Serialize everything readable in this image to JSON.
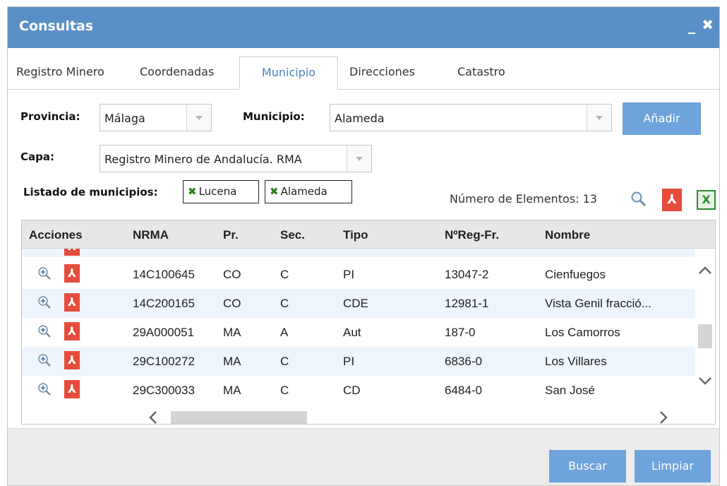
{
  "window": {
    "title": "Consultas",
    "minimize": "_",
    "close": "✖"
  },
  "tabs": [
    {
      "label": "Registro Minero"
    },
    {
      "label": "Coordenadas"
    },
    {
      "label": "Municipio"
    },
    {
      "label": "Direcciones"
    },
    {
      "label": "Catastro"
    }
  ],
  "form": {
    "provincia_label": "Provincia:",
    "provincia_value": "Málaga",
    "municipio_label": "Municipio:",
    "municipio_value": "Alameda",
    "add_label": "Añadir",
    "capa_label": "Capa:",
    "capa_value": "Registro Minero de Andalucía. RMA",
    "list_label": "Listado de municipios:",
    "chips": [
      {
        "label": "Lucena"
      },
      {
        "label": "Alameda"
      }
    ],
    "count_text": "Número de Elementos: 13"
  },
  "grid": {
    "headers": [
      "Acciones",
      "NRMA",
      "Pr.",
      "Sec.",
      "Tipo",
      "NºReg-Fr.",
      "Nombre"
    ],
    "rows": [
      {
        "nrma": "14C100645",
        "pr": "CO",
        "sec": "C",
        "tipo": "PI",
        "nreg": "13047-2",
        "nombre": "Cienfuegos"
      },
      {
        "nrma": "14C200165",
        "pr": "CO",
        "sec": "C",
        "tipo": "CDE",
        "nreg": "12981-1",
        "nombre": "Vista Genil fracció..."
      },
      {
        "nrma": "29A000051",
        "pr": "MA",
        "sec": "A",
        "tipo": "Aut",
        "nreg": "187-0",
        "nombre": "Los Camorros"
      },
      {
        "nrma": "29C100272",
        "pr": "MA",
        "sec": "C",
        "tipo": "PI",
        "nreg": "6836-0",
        "nombre": "Los Villares"
      },
      {
        "nrma": "29C300033",
        "pr": "MA",
        "sec": "C",
        "tipo": "CD",
        "nreg": "6484-0",
        "nombre": "San José"
      }
    ]
  },
  "footer": {
    "search_label": "Buscar",
    "clear_label": "Limpiar"
  },
  "colors": {
    "accent": "#5b8fc7",
    "button": "#6fa3db",
    "pdf": "#e64c3c",
    "excel": "#2e8b2e",
    "row_alt": "#eef5fc"
  },
  "icons": {
    "zoom": "magnifier-plus-icon",
    "pdf": "pdf-icon",
    "excel": "excel-icon"
  }
}
